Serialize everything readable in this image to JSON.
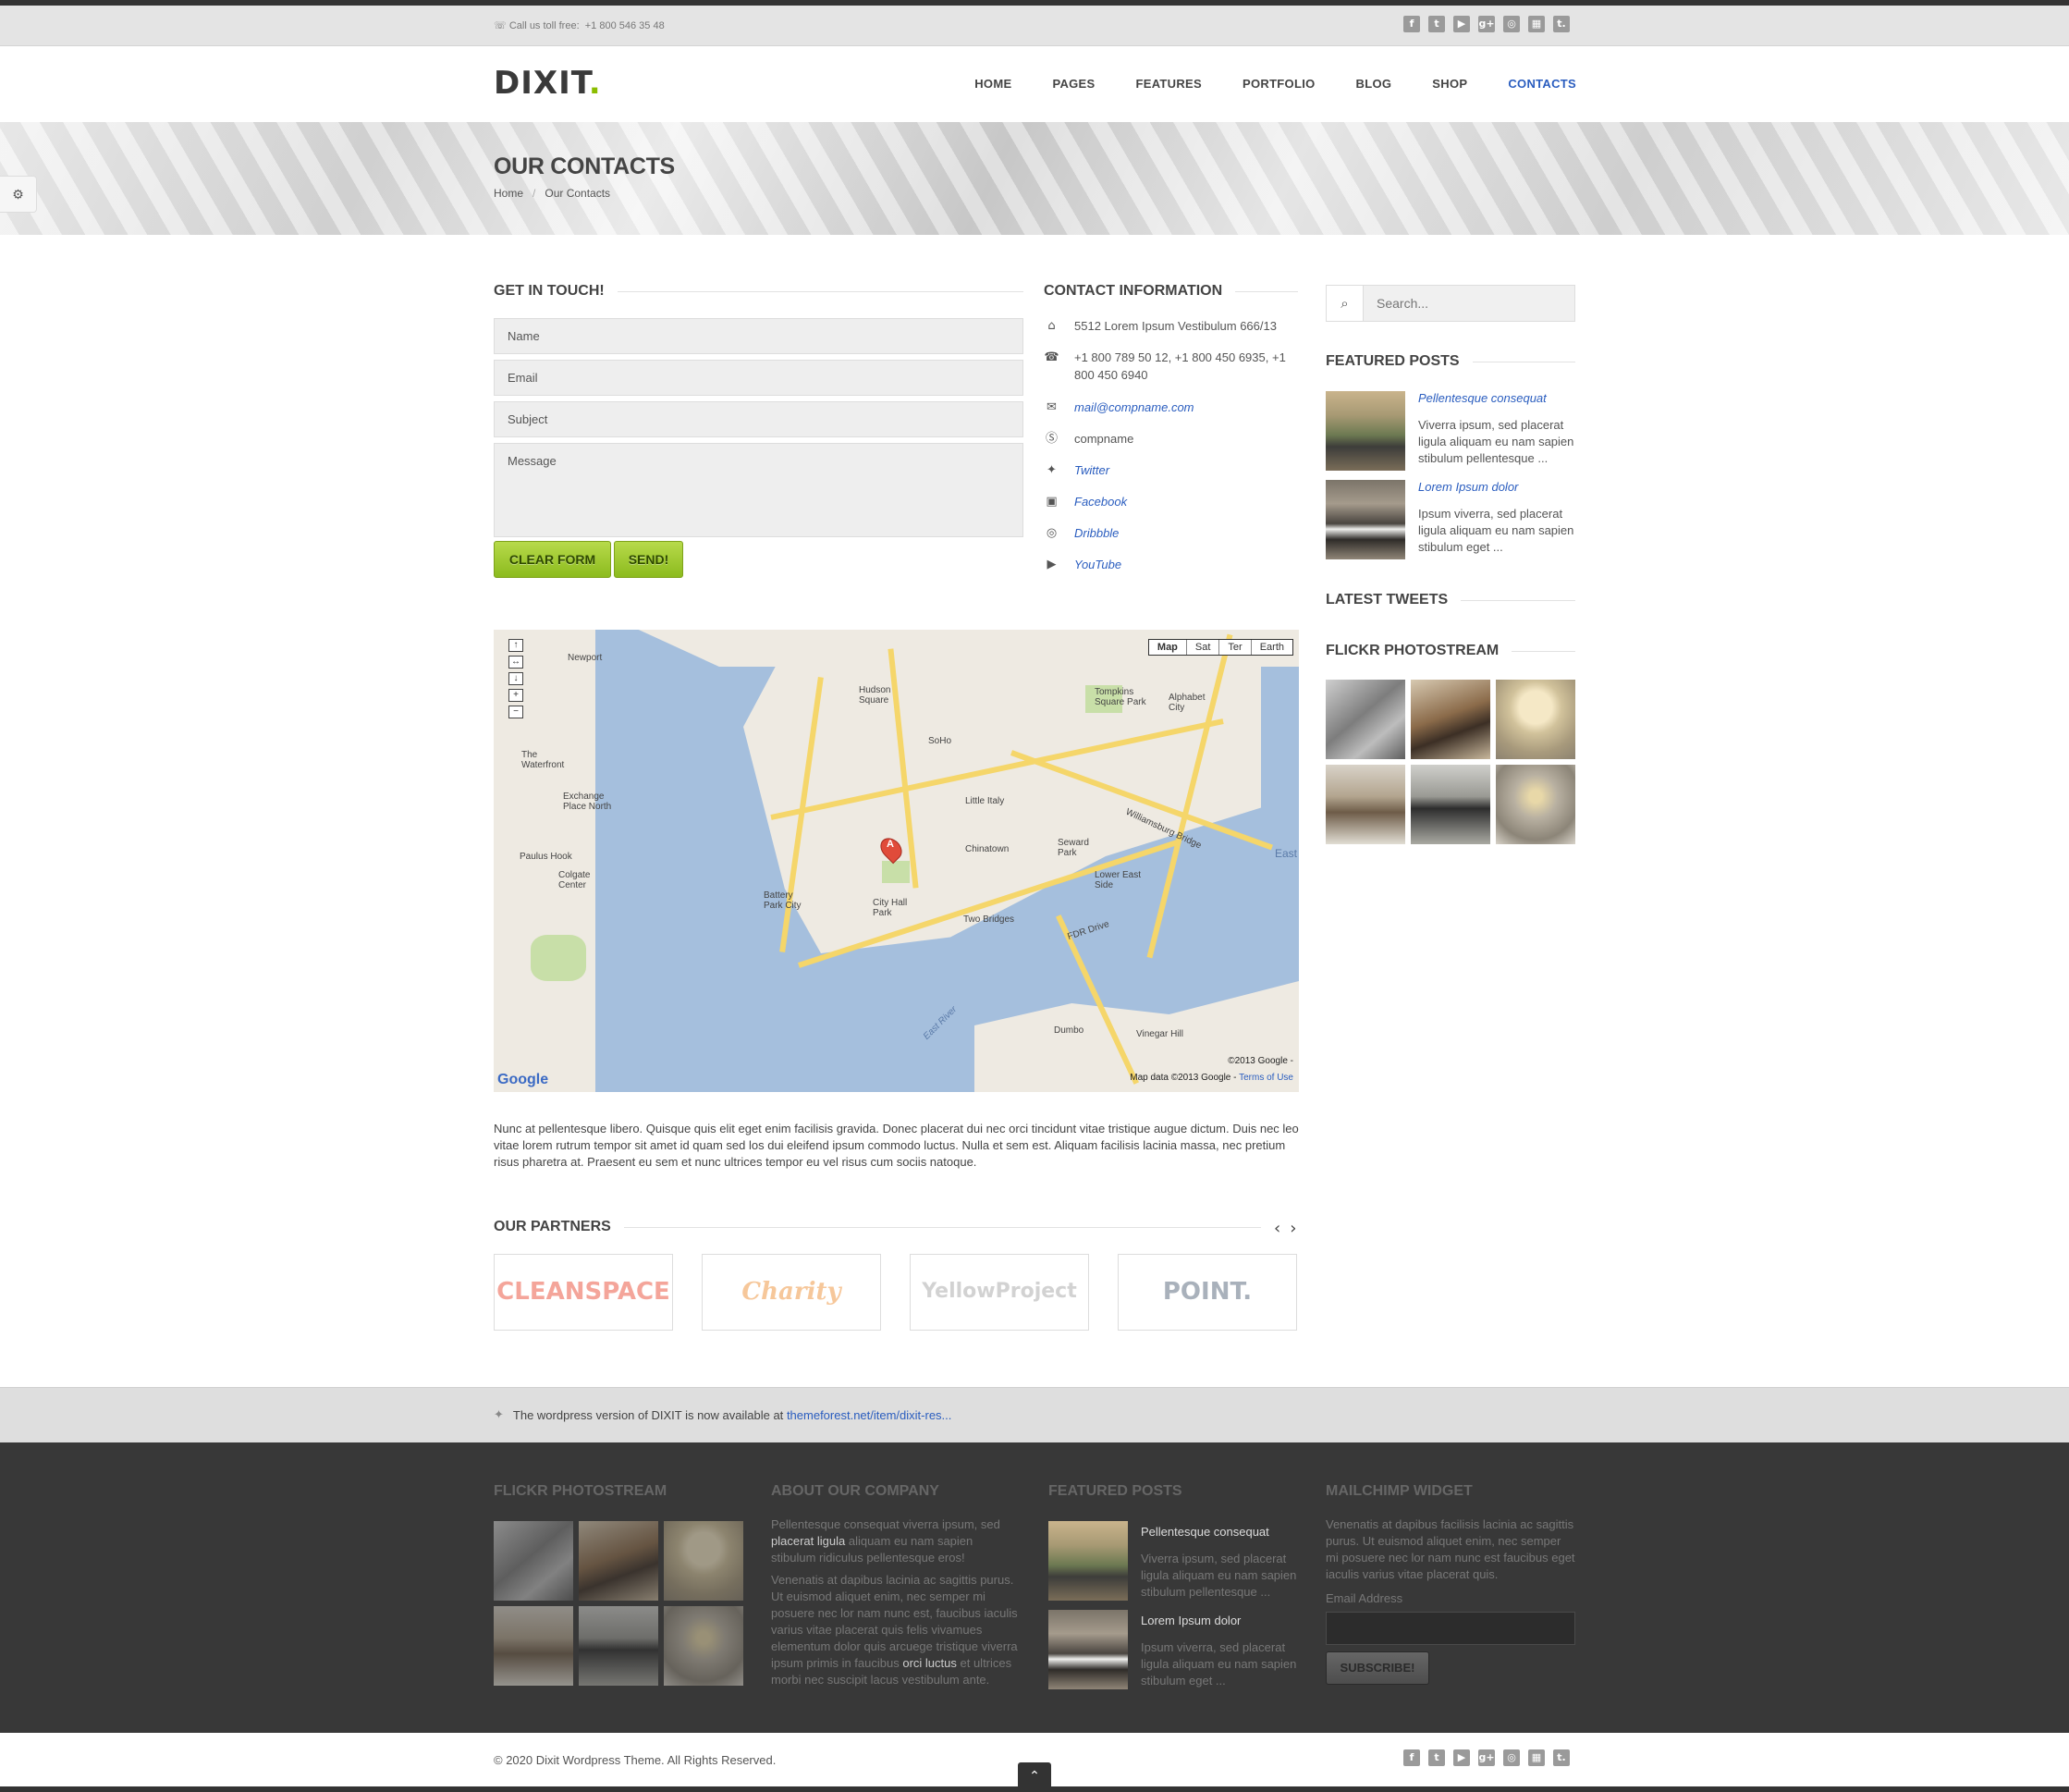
{
  "topbar": {
    "phone_label": "Call us toll free:",
    "phone_number": "+1 800 546 35 48",
    "social": [
      "facebook-icon",
      "twitter-icon",
      "youtube-icon",
      "google-plus-icon",
      "dribbble-icon",
      "delicious-icon",
      "tumblr-icon"
    ],
    "social_glyphs": [
      "f",
      "t",
      "▶",
      "g+",
      "◎",
      "▦",
      "t."
    ]
  },
  "header": {
    "logo": "DIXIT",
    "logo_dot": ".",
    "nav": [
      "HOME",
      "PAGES",
      "FEATURES",
      "PORTFOLIO",
      "BLOG",
      "SHOP",
      "CONTACTS"
    ],
    "active_nav": "CONTACTS"
  },
  "banner": {
    "title": "OUR CONTACTS",
    "breadcrumb": [
      "Home",
      "Our Contacts"
    ]
  },
  "form": {
    "title": "GET IN TOUCH!",
    "name_placeholder": "Name",
    "email_placeholder": "Email",
    "subject_placeholder": "Subject",
    "message_placeholder": "Message",
    "clear_label": "CLEAR FORM",
    "send_label": "SEND!"
  },
  "contact": {
    "title": "CONTACT INFORMATION",
    "address": "5512 Lorem Ipsum Vestibulum 666/13",
    "phones": "+1 800 789 50 12, +1 800 450 6935, +1 800 450 6940",
    "email": "mail@compname.com",
    "skype": "compname",
    "twitter": "Twitter",
    "facebook": "Facebook",
    "dribbble": "Dribbble",
    "youtube": "YouTube"
  },
  "sidebar": {
    "search_placeholder": "Search...",
    "featured_title": "FEATURED POSTS",
    "posts": [
      {
        "title": "Pellentesque consequat",
        "excerpt": "Viverra ipsum, sed placerat ligula aliquam eu nam sapien stibulum pellentesque ..."
      },
      {
        "title": "Lorem Ipsum dolor",
        "excerpt": "Ipsum viverra, sed placerat ligula aliquam eu nam sapien stibulum eget ..."
      }
    ],
    "tweets_title": "LATEST TWEETS",
    "flickr_title": "FLICKR PHOTOSTREAM"
  },
  "map": {
    "types": [
      "Map",
      "Sat",
      "Ter",
      "Earth"
    ],
    "selected_type": "Map",
    "copyright": "©2013 Google -",
    "data_label": "Map data ©2013 Google -",
    "terms": "Terms of Use",
    "powered": "Google",
    "labels": {
      "newport": "Newport",
      "hudson": "Hudson Square",
      "soho": "SoHo",
      "little_italy": "Little Italy",
      "chinatown": "Chinatown",
      "seward": "Seward Park",
      "lower_east": "Lower East Side",
      "two_bridges": "Two Bridges",
      "city_hall": "City Hall Park",
      "battery": "Battery Park City",
      "dumbo": "Dumbo",
      "williamsburg": "Williamsburg Bridge",
      "fdr": "FDR Drive",
      "east_river": "East River",
      "waterfront": "The Waterfront",
      "exchange": "Exchange Place North",
      "paulus": "Paulus Hook",
      "colgate": "Colgate Center",
      "tompkins": "Tompkins Square Park",
      "alphabet": "Alphabet City",
      "vinegar": "Vinegar Hill",
      "east": "East",
      "marker": "A"
    }
  },
  "body_text": "Nunc at pellentesque libero. Quisque quis elit eget enim facilisis gravida. Donec placerat dui nec orci tincidunt vitae tristique augue dictum. Duis nec leo vitae lorem rutrum tempor sit amet id quam sed los dui eleifend ipsum commodo luctus. Nulla et sem est. Aliquam facilisis lacinia massa, nec pretium risus pharetra at. Praesent eu sem et nunc ultrices tempor eu vel risus cum sociis natoque.",
  "partners": {
    "title": "OUR PARTNERS",
    "prev": "‹",
    "next": "›",
    "items": [
      {
        "name": "CLEANSPACE",
        "color": "#f4a59a"
      },
      {
        "name": "Charity",
        "color": "#f6c79a"
      },
      {
        "name": "YellowProject",
        "color": "#d9d9d9"
      },
      {
        "name": "POINT.",
        "color": "#b0b8c2"
      }
    ]
  },
  "twitterbar": {
    "text": "The wordpress version of DIXIT is now available at",
    "link": "themeforest.net/item/dixit-res..."
  },
  "footer": {
    "flickr_title": "FLICKR PHOTOSTREAM",
    "about_title": "ABOUT OUR COMPANY",
    "about_p1_a": "Pellentesque consequat viverra ipsum, sed",
    "about_p1_b": "placerat ligula",
    "about_p1_c": "aliquam eu nam sapien stibulum ridiculus pellentesque eros!",
    "about_p2_a": "Venenatis at dapibus lacinia ac sagittis purus. Ut euismod aliquet enim, nec semper mi posuere nec lor nam nunc est, faucibus iaculis varius vitae placerat quis felis vivamues elementum dolor quis arcuege tristique viverra ipsum primis in faucibus",
    "about_p2_b": "orci luctus",
    "about_p2_c": "et ultrices morbi nec suscipit lacus vestibulum ante.",
    "featured_title": "FEATURED POSTS",
    "posts": [
      {
        "title": "Pellentesque consequat",
        "excerpt": "Viverra ipsum, sed placerat ligula aliquam eu nam sapien stibulum pellentesque ..."
      },
      {
        "title": "Lorem Ipsum dolor",
        "excerpt": "Ipsum viverra, sed placerat ligula aliquam eu nam sapien stibulum eget ..."
      }
    ],
    "mailchimp_title": "MAILCHIMP WIDGET",
    "mailchimp_text": "Venenatis at dapibus facilisis lacinia ac sagittis purus. Ut euismod aliquet enim, nec semper mi posuere nec lor nam nunc est faucibus eget iaculis varius vitae placerat quis.",
    "email_label": "Email Address",
    "subscribe_label": "SUBSCRIBE!"
  },
  "bottombar": {
    "copyright": "© 2020 Dixit Wordpress Theme. All Rights Reserved.",
    "totop": "⌃"
  }
}
